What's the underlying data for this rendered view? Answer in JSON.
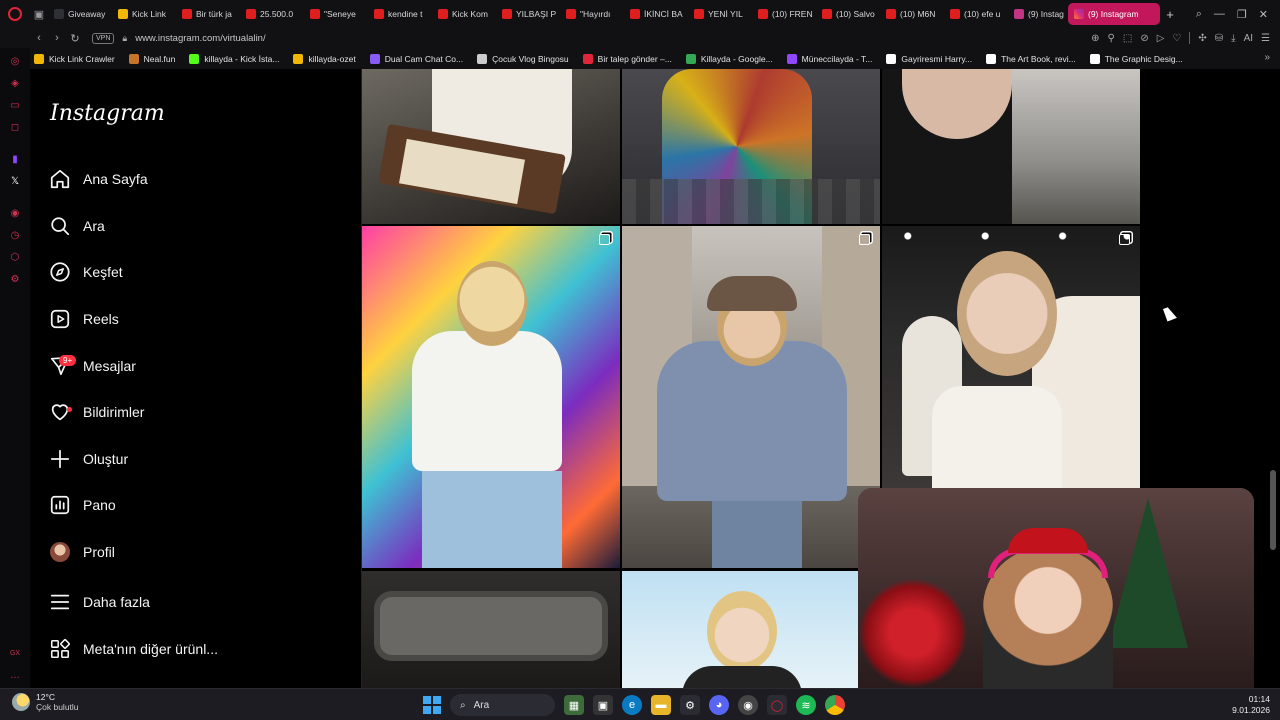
{
  "browser": {
    "tabs": [
      {
        "label": "Giveaway",
        "color": "#2f2f36"
      },
      {
        "label": "Kick Link",
        "color": "#f2b705"
      },
      {
        "label": "Bir türk ja",
        "color": "#e01e1e"
      },
      {
        "label": "25.500.0",
        "color": "#e01e1e"
      },
      {
        "label": "\"Seneye",
        "color": "#e01e1e"
      },
      {
        "label": "kendine t",
        "color": "#e01e1e"
      },
      {
        "label": "Kick Kom",
        "color": "#e01e1e"
      },
      {
        "label": "YILBAŞI P",
        "color": "#e01e1e"
      },
      {
        "label": "\"Hayırdı",
        "color": "#e01e1e"
      },
      {
        "label": "İKİNCİ BA",
        "color": "#e01e1e"
      },
      {
        "label": "YENİ YIL",
        "color": "#e01e1e"
      },
      {
        "label": "(10) FREN",
        "color": "#e01e1e"
      },
      {
        "label": "(10) Salvo",
        "color": "#e01e1e"
      },
      {
        "label": "(10) M6N",
        "color": "#e01e1e"
      },
      {
        "label": "(10) efe u",
        "color": "#e01e1e"
      },
      {
        "label": "(9) Instag",
        "color": "#c13584"
      }
    ],
    "active_tab": "(9) Instagram",
    "new_tab_symbol": "+",
    "vpn_label": "VPN",
    "url": "www.instagram.com/virtualalin/",
    "ai_label": "AI",
    "bookmarks": [
      {
        "label": "Kick Link Crawler",
        "color": "#f2b705"
      },
      {
        "label": "Neal.fun",
        "color": "#c8742a"
      },
      {
        "label": "killayda - Kick İsta...",
        "color": "#53fc18"
      },
      {
        "label": "killayda-ozet",
        "color": "#f2b705"
      },
      {
        "label": "Dual Cam Chat Co...",
        "color": "#8a5cf6"
      },
      {
        "label": "Çocuk Vlog Bingosu",
        "color": "#cccccc"
      },
      {
        "label": "Bir talep gönder –...",
        "color": "#e0243a"
      },
      {
        "label": "Killayda - Google...",
        "color": "#34a853"
      },
      {
        "label": "Müneccilayda - T...",
        "color": "#9146ff"
      },
      {
        "label": "Gayriresmi Harry...",
        "color": "#ffffff"
      },
      {
        "label": "The Art Book, revi...",
        "color": "#ffffff"
      },
      {
        "label": "The Graphic Desig...",
        "color": "#ffffff"
      }
    ]
  },
  "instagram": {
    "logo": "Instagram",
    "nav": [
      {
        "label": "Ana Sayfa",
        "icon": "home-icon"
      },
      {
        "label": "Ara",
        "icon": "search-icon"
      },
      {
        "label": "Keşfet",
        "icon": "compass-icon"
      },
      {
        "label": "Reels",
        "icon": "reels-icon"
      },
      {
        "label": "Mesajlar",
        "icon": "messenger-icon",
        "badge": "9+"
      },
      {
        "label": "Bildirimler",
        "icon": "heart-icon"
      },
      {
        "label": "Oluştur",
        "icon": "plus-icon"
      },
      {
        "label": "Pano",
        "icon": "dashboard-icon"
      },
      {
        "label": "Profil",
        "icon": "avatar"
      },
      {
        "label": "Daha fazla",
        "icon": "menu-icon"
      },
      {
        "label": "Meta'nın diğer ürünl...",
        "icon": "apps-icon"
      }
    ]
  },
  "taskbar": {
    "weather_temp": "12°C",
    "weather_desc": "Çok bulutlu",
    "search_label": "Ara",
    "time": "01:14",
    "date": "9.01.2026",
    "accent": "#3fa9f5"
  }
}
